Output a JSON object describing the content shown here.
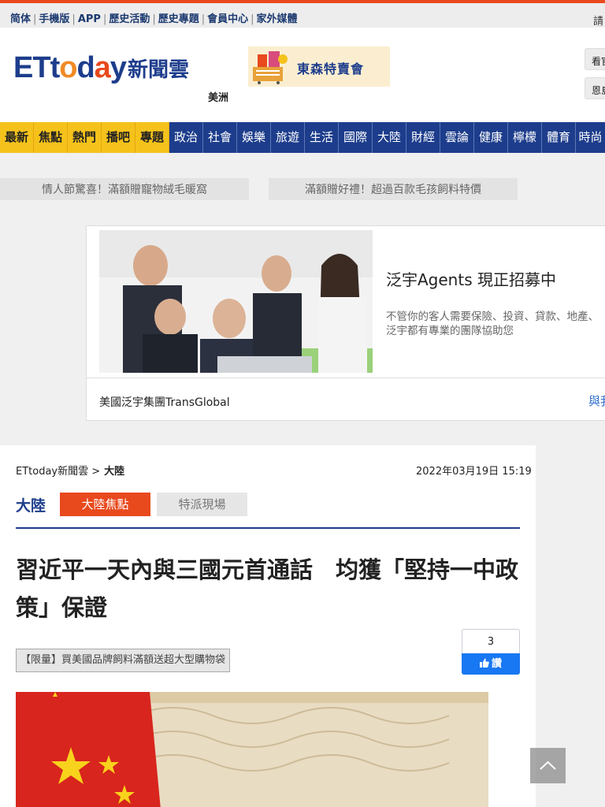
{
  "topbar": {
    "links": [
      "简体",
      "手機版",
      "APP",
      "歷史活動",
      "歷史專題",
      "會員中心",
      "家外媒體"
    ],
    "right_text": "請"
  },
  "header": {
    "logo_en": "ETtoday",
    "logo_zh": "新聞雲",
    "region": "美洲",
    "banner_text": "東森特賣會",
    "side_buttons": [
      "看官",
      "恩島"
    ]
  },
  "nav": {
    "items": [
      "最新",
      "焦點",
      "熱門",
      "播吧",
      "專題",
      "政治",
      "社會",
      "娛樂",
      "旅遊",
      "生活",
      "國際",
      "大陸",
      "財經",
      "雲論",
      "健康",
      "檸檬",
      "體育",
      "時尚"
    ]
  },
  "promos": [
    "情人節驚喜！滿額贈寵物絨毛暖窩",
    "滿額贈好禮！超過百款毛孩飼料特價"
  ],
  "ad": {
    "title": "泛宇Agents 現正招募中",
    "desc_line1": "不管你的客人需要保險、投資、貸款、地產、",
    "desc_line2": "泛宇都有專業的團隊協助您",
    "sponsor": "美國泛宇集團TransGlobal",
    "link": "與我"
  },
  "article": {
    "breadcrumb_site": "ETtoday新聞雲 >",
    "breadcrumb_section": "大陸",
    "date": "2022年03月19日 15:19",
    "section_name": "大陸",
    "tabs": [
      "大陸焦點",
      "特派現場"
    ],
    "headline": "習近平一天內與三國元首通話　均獲「堅持一中政策」保證",
    "like_count": "3",
    "like_label": "讚",
    "promo_tag": "【限量】買美國品牌飼料滿額送超大型購物袋"
  },
  "icons": {
    "back_to_top": "chevron-up-icon",
    "like": "thumbs-up-icon",
    "banner": "shopping-basket-icon"
  },
  "colors": {
    "brand_blue": "#1d3d8c",
    "brand_orange": "#e8491d",
    "nav_highlight": "#f5c21b",
    "facebook_blue": "#1877f2"
  }
}
